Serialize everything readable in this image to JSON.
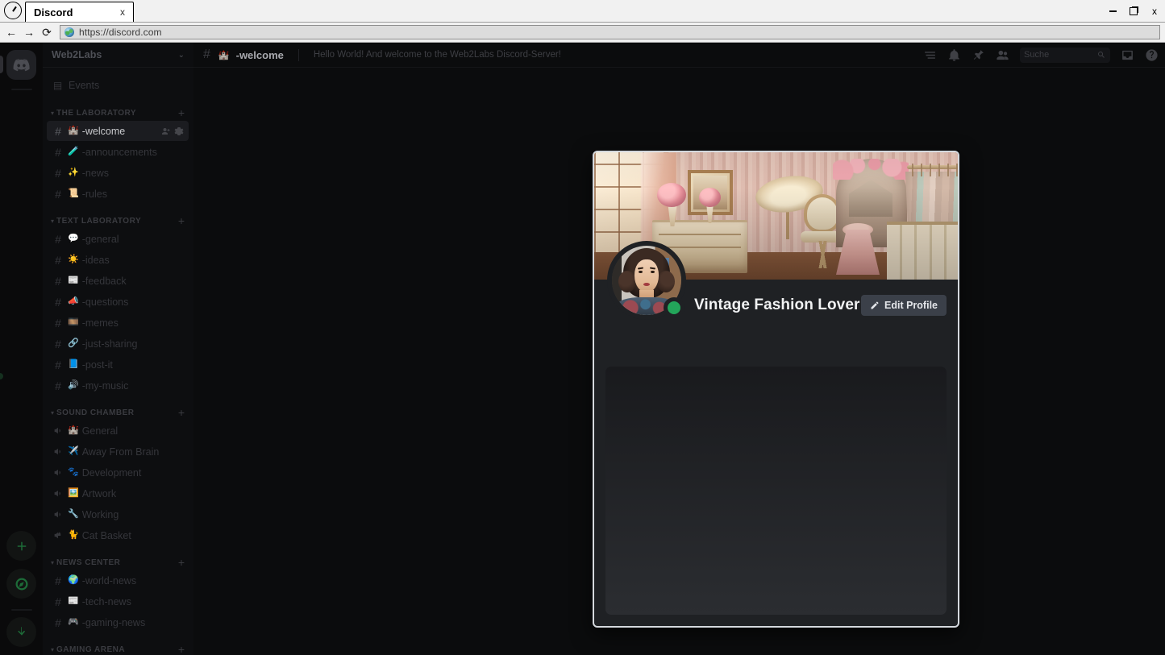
{
  "browser": {
    "app_icon": "clock-icon",
    "tab_title": "Discord",
    "tab_close": "x",
    "back_icon": "←",
    "forward_icon": "→",
    "reload_icon": "⟳",
    "url": "https://discord.com",
    "window_minimize": "minimize-icon",
    "window_maximize": "maximize-icon",
    "window_close": "x"
  },
  "rail": {
    "home_icon": "discord-logo-icon",
    "add_server_icon": "plus-icon",
    "explore_icon": "compass-icon",
    "download_icon": "download-icon"
  },
  "sidebar": {
    "server_name": "Web2Labs",
    "chevron_icon": "chevron-down-icon",
    "events": {
      "label": "Events",
      "icon": "calendar-icon"
    },
    "categories": [
      {
        "name": "THE LABORATORY",
        "add_icon": "plus-icon",
        "channels": [
          {
            "emoji": "🏰",
            "name": "-welcome",
            "selected": true,
            "actions": [
              "invite-icon",
              "gear-icon"
            ]
          },
          {
            "emoji": "🧪",
            "name": "-announcements",
            "selected": false
          },
          {
            "emoji": "✨",
            "name": "-news",
            "selected": false
          },
          {
            "emoji": "📜",
            "name": "-rules",
            "selected": false
          }
        ]
      },
      {
        "name": "TEXT LABORATORY",
        "add_icon": "plus-icon",
        "channels": [
          {
            "emoji": "💬",
            "name": "-general",
            "selected": false
          },
          {
            "emoji": "☀️",
            "name": "-ideas",
            "selected": false
          },
          {
            "emoji": "📰",
            "name": "-feedback",
            "selected": false
          },
          {
            "emoji": "📣",
            "name": "-questions",
            "selected": false
          },
          {
            "emoji": "🎞️",
            "name": "-memes",
            "selected": false
          },
          {
            "emoji": "🔗",
            "name": "-just-sharing",
            "selected": false
          },
          {
            "emoji": "📘",
            "name": "-post-it",
            "selected": false
          },
          {
            "emoji": "🔊",
            "name": "-my-music",
            "selected": false
          }
        ]
      },
      {
        "name": "SOUND CHAMBER",
        "add_icon": "plus-icon",
        "voice_channels": [
          {
            "emoji": "🏰",
            "name": "General"
          },
          {
            "emoji": "✈️",
            "name": "Away From Brain"
          },
          {
            "emoji": "🐾",
            "name": "Development"
          },
          {
            "emoji": "🖼️",
            "name": "Artwork"
          },
          {
            "emoji": "🔧",
            "name": "Working"
          },
          {
            "emoji": "🐈",
            "name": "Cat Basket",
            "locked": true
          }
        ]
      },
      {
        "name": "NEWS CENTER",
        "add_icon": "plus-icon",
        "channels": [
          {
            "emoji": "🌍",
            "name": "-world-news",
            "selected": false
          },
          {
            "emoji": "📰",
            "name": "-tech-news",
            "selected": false
          },
          {
            "emoji": "🎮",
            "name": "-gaming-news",
            "selected": false
          }
        ]
      },
      {
        "name": "GAMING ARENA",
        "add_icon": "plus-icon",
        "channels": []
      }
    ]
  },
  "topbar": {
    "hash_icon": "hash-icon",
    "channel_emoji": "🏰",
    "channel_name": "-welcome",
    "topic": "Hello World! And welcome to the Web2Labs Discord-Server!",
    "icons": [
      "threads-icon",
      "bell-icon",
      "pin-icon",
      "members-icon"
    ],
    "search_placeholder": "Suche",
    "search_icon": "search-icon",
    "inbox_icon": "inbox-icon",
    "help_icon": "help-icon"
  },
  "profile_modal": {
    "banner_alt": "vintage-fashion-room-banner",
    "avatar_alt": "vintage-woman-avatar",
    "status": "online",
    "status_color": "#23a55a",
    "display_name": "Vintage Fashion Lover",
    "edit_button_label": "Edit Profile",
    "edit_button_icon": "pencil-icon"
  }
}
